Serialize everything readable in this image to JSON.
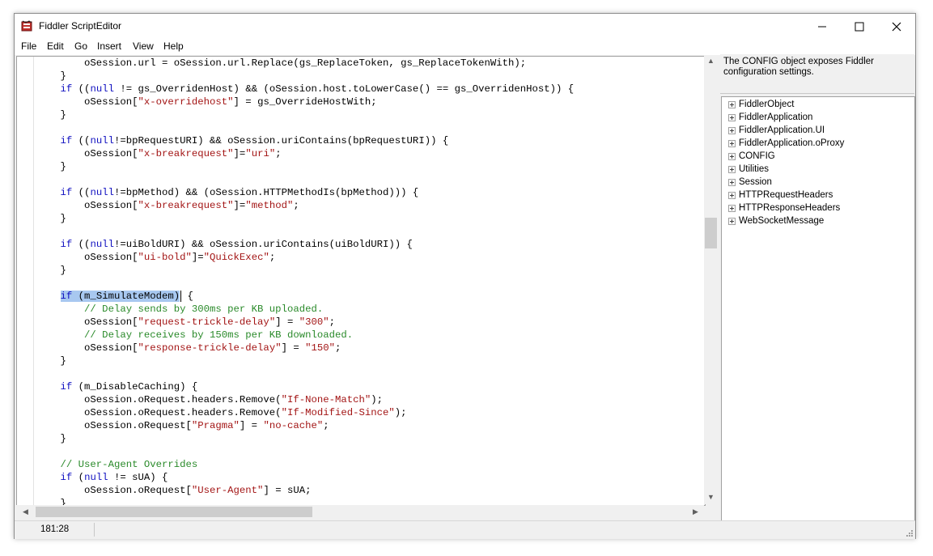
{
  "window": {
    "title": "Fiddler ScriptEditor"
  },
  "icons": {
    "app": "fiddler-script-icon",
    "minimize": "minimize-icon",
    "maximize": "maximize-icon",
    "close": "close-icon",
    "expander": "plus-expander-icon"
  },
  "menu": {
    "file": "File",
    "edit": "Edit",
    "go": "Go",
    "insert": "Insert",
    "view": "View",
    "help": "Help"
  },
  "code": {
    "l0": "oSession.url = oSession.url.Replace(gs_ReplaceToken, gs_ReplaceTokenWith);",
    "l1": "}",
    "l2a": "if",
    "l2b": " ((",
    "l2c": "null",
    "l2d": " != gs_OverridenHost) && (oSession.host.toLowerCase() == gs_OverridenHost)) {",
    "l3a": "oSession[",
    "l3b": "\"x-overridehost\"",
    "l3c": "] = gs_OverrideHostWith;",
    "l4": "}",
    "l6a": "if",
    "l6b": " ((",
    "l6c": "null",
    "l6d": "!=bpRequestURI) && oSession.uriContains(bpRequestURI)) {",
    "l7a": "oSession[",
    "l7b": "\"x-breakrequest\"",
    "l7c": "]=",
    "l7d": "\"uri\"",
    "l7e": ";",
    "l8": "}",
    "l10a": "if",
    "l10b": " ((",
    "l10c": "null",
    "l10d": "!=bpMethod) && (oSession.HTTPMethodIs(bpMethod))) {",
    "l11a": "oSession[",
    "l11b": "\"x-breakrequest\"",
    "l11c": "]=",
    "l11d": "\"method\"",
    "l11e": ";",
    "l12": "}",
    "l14a": "if",
    "l14b": " ((",
    "l14c": "null",
    "l14d": "!=uiBoldURI) && oSession.uriContains(uiBoldURI)) {",
    "l15a": "oSession[",
    "l15b": "\"ui-bold\"",
    "l15c": "]=",
    "l15d": "\"QuickExec\"",
    "l15e": ";",
    "l16": "}",
    "l18a": "if",
    "l18b": " (m_SimulateModem)",
    "l18c": " {",
    "l19": "// Delay sends by 300ms per KB uploaded.",
    "l20a": "oSession[",
    "l20b": "\"request-trickle-delay\"",
    "l20c": "] = ",
    "l20d": "\"300\"",
    "l20e": ";",
    "l21": "// Delay receives by 150ms per KB downloaded.",
    "l22a": "oSession[",
    "l22b": "\"response-trickle-delay\"",
    "l22c": "] = ",
    "l22d": "\"150\"",
    "l22e": ";",
    "l23": "}",
    "l25a": "if",
    "l25b": " (m_DisableCaching) {",
    "l26a": "oSession.oRequest.headers.Remove(",
    "l26b": "\"If-None-Match\"",
    "l26c": ");",
    "l27a": "oSession.oRequest.headers.Remove(",
    "l27b": "\"If-Modified-Since\"",
    "l27c": ");",
    "l28a": "oSession.oRequest[",
    "l28b": "\"Pragma\"",
    "l28c": "] = ",
    "l28d": "\"no-cache\"",
    "l28e": ";",
    "l29": "}",
    "l31": "// User-Agent Overrides",
    "l32a": "if",
    "l32b": " (",
    "l32c": "null",
    "l32d": " != sUA) {",
    "l33a": "oSession.oRequest[",
    "l33b": "\"User-Agent\"",
    "l33c": "] = sUA;",
    "l34": "}"
  },
  "sidebar": {
    "description": "The CONFIG object exposes Fiddler configuration settings.",
    "tree": [
      "FiddlerObject",
      "FiddlerApplication",
      "FiddlerApplication.UI",
      "FiddlerApplication.oProxy",
      "CONFIG",
      "Utilities",
      "Session",
      "HTTPRequestHeaders",
      "HTTPResponseHeaders",
      "WebSocketMessage"
    ]
  },
  "status": {
    "position": "181:28"
  }
}
